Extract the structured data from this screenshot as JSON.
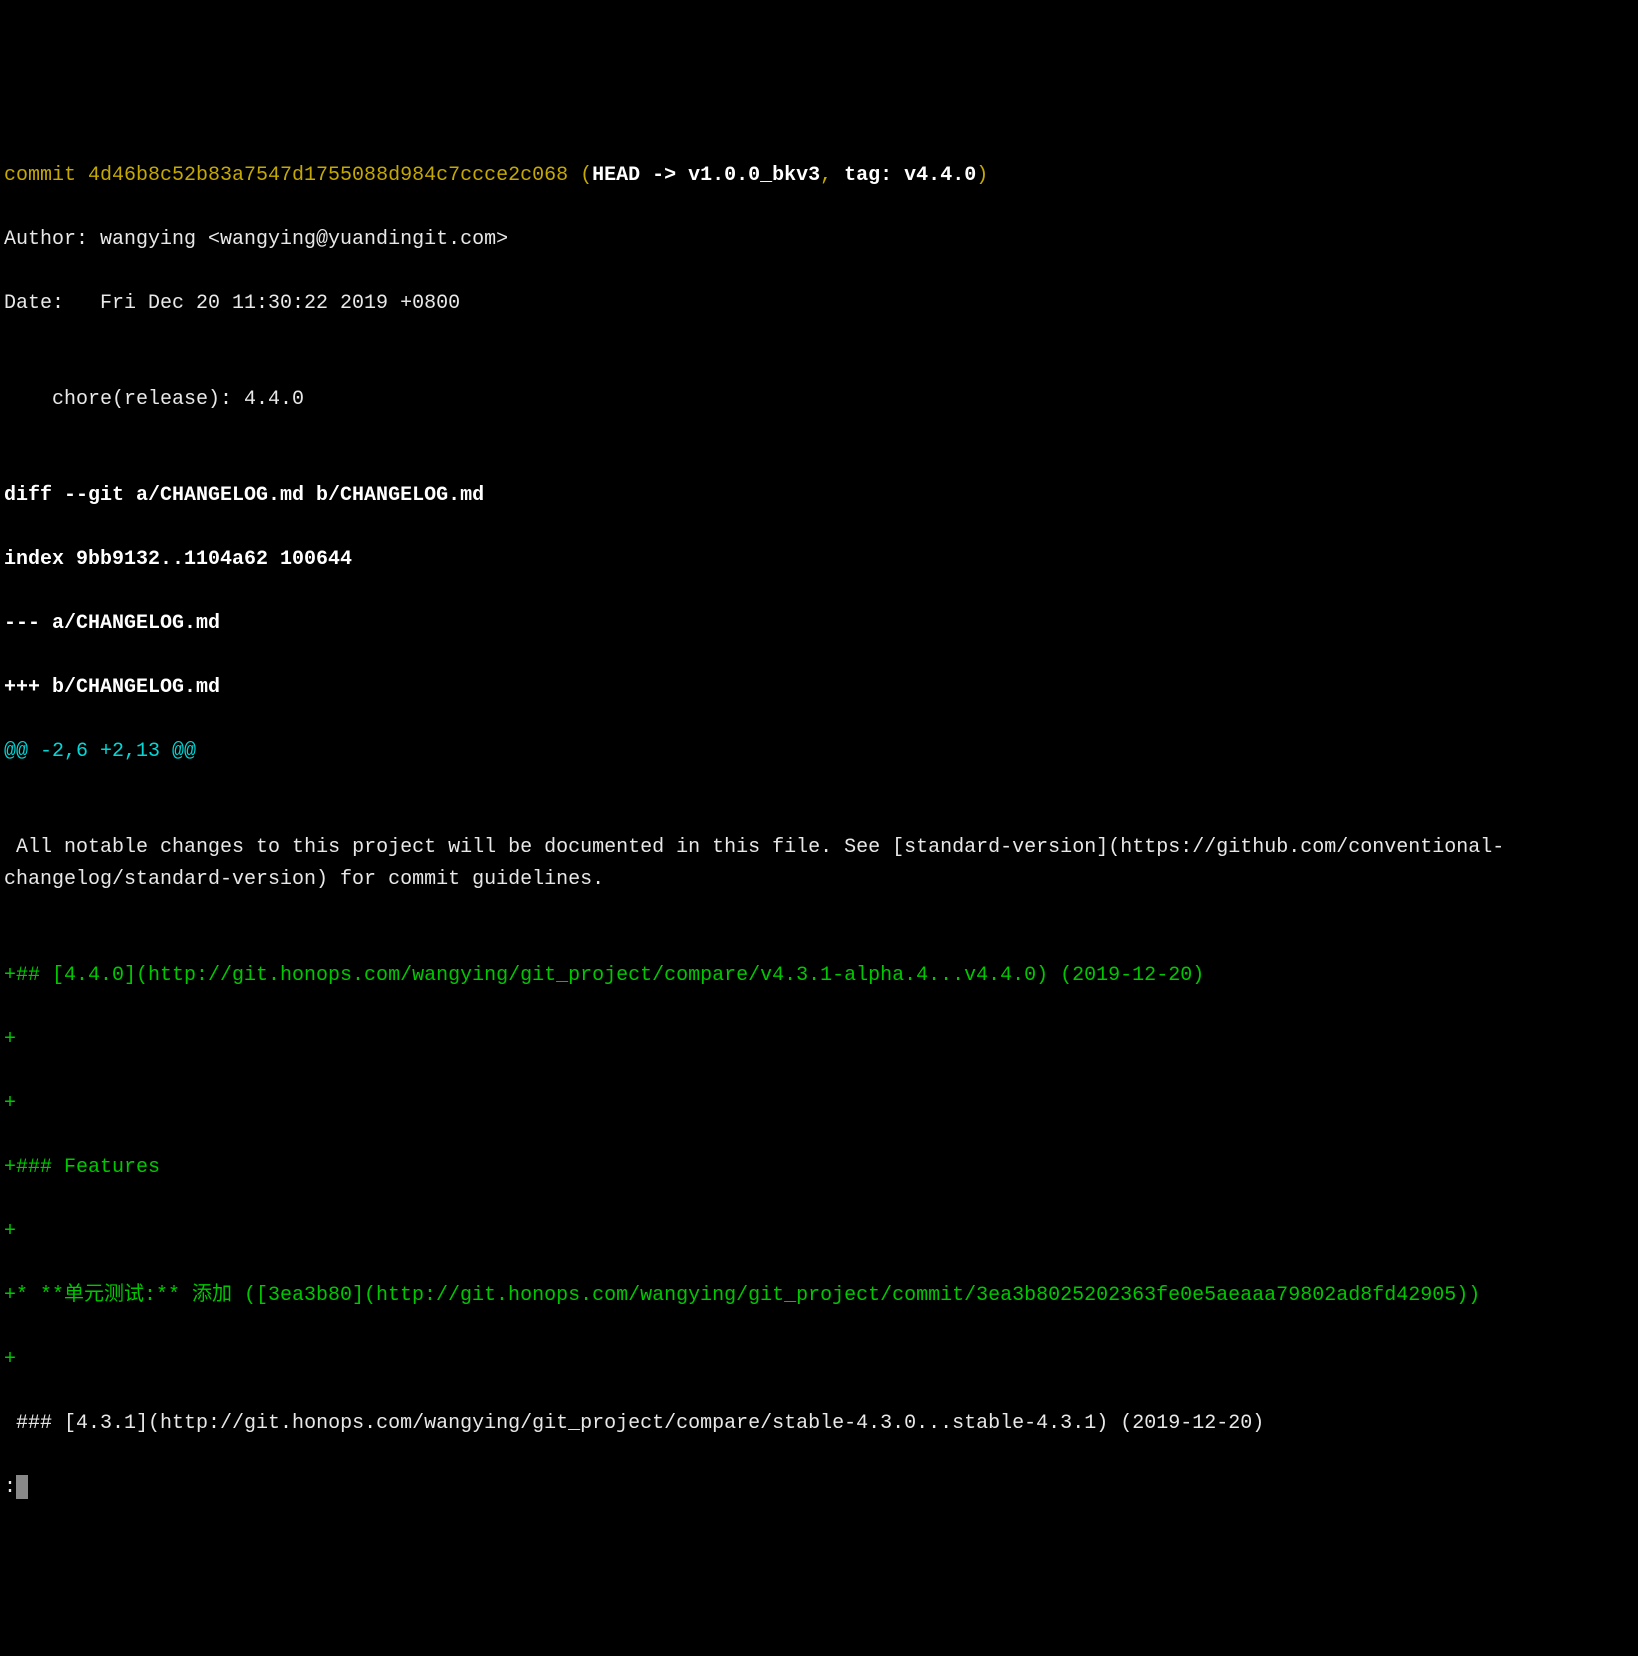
{
  "commit": {
    "label": "commit ",
    "hash": "4d46b8c52b83a7547d1755088d984c7ccce2c068",
    "paren_open": " (",
    "head": "HEAD -> ",
    "branch": "v1.0.0_bkv3",
    "comma": ", ",
    "tag_label": "tag: v4.4.0",
    "paren_close": ")"
  },
  "author": "Author: wangying <wangying@yuandingit.com>",
  "date": "Date:   Fri Dec 20 11:30:22 2019 +0800",
  "blank1": "",
  "message": "    chore(release): 4.4.0",
  "blank2": "",
  "diff_header": {
    "diff_line": "diff --git a/CHANGELOG.md b/CHANGELOG.md",
    "index_line": "index 9bb9132..1104a62 100644",
    "minus_file": "--- a/CHANGELOG.md",
    "plus_file": "+++ b/CHANGELOG.md"
  },
  "hunk": "@@ -2,6 +2,13 @@",
  "blank3": "",
  "context1": " All notable changes to this project will be documented in this file. See [standard-version](https://github.com/conventional-changelog/standard-version) for commit guidelines.",
  "blank4": "",
  "added": {
    "l1": "+## [4.4.0](http://git.honops.com/wangying/git_project/compare/v4.3.1-alpha.4...v4.4.0) (2019-12-20)",
    "l2": "+",
    "l3": "+",
    "l4": "+### Features",
    "l5": "+",
    "l6": "+* **单元测试:** 添加 ([3ea3b80](http://git.honops.com/wangying/git_project/commit/3ea3b8025202363fe0e5aeaaa79802ad8fd42905))",
    "l7": "+"
  },
  "context2": " ### [4.3.1](http://git.honops.com/wangying/git_project/compare/stable-4.3.0...stable-4.3.1) (2019-12-20)",
  "pager": ":"
}
